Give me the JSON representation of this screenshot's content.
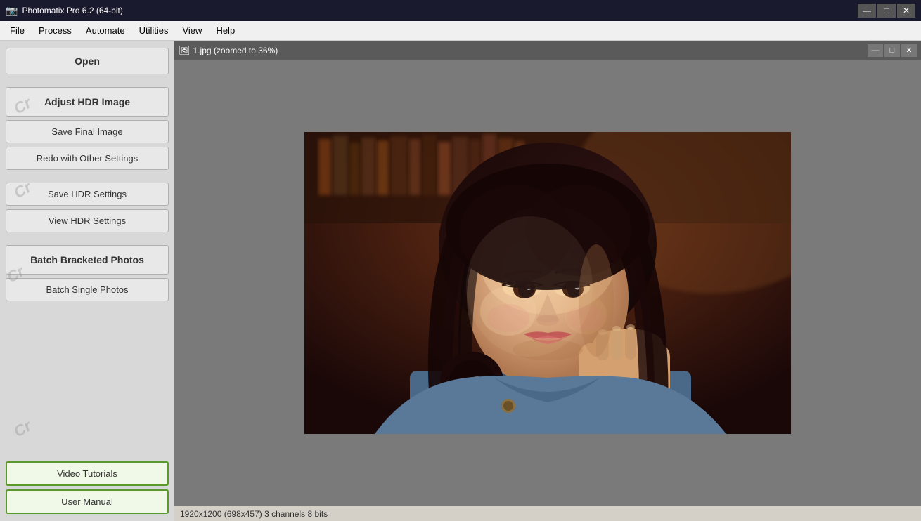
{
  "titlebar": {
    "icon": "📷",
    "title": "Photomatix Pro 6.2 (64-bit)",
    "minimize": "—",
    "maximize": "□",
    "close": "✕"
  },
  "menubar": {
    "items": [
      "File",
      "Process",
      "Automate",
      "Utilities",
      "View",
      "Help"
    ]
  },
  "sidebar": {
    "open_label": "Open",
    "adjust_hdr_label": "Adjust HDR Image",
    "save_final_label": "Save Final Image",
    "redo_label": "Redo with Other Settings",
    "save_hdr_settings_label": "Save HDR Settings",
    "view_hdr_settings_label": "View HDR Settings",
    "batch_bracketed_label": "Batch Bracketed Photos",
    "batch_single_label": "Batch Single Photos",
    "video_tutorials_label": "Video Tutorials",
    "user_manual_label": "User Manual",
    "watermarks": [
      "Cr",
      "Cr",
      "Cr",
      "Cr"
    ]
  },
  "image_window": {
    "title": "1.jpg (zoomed to 36%)",
    "minimize": "—",
    "restore": "□",
    "close": "✕"
  },
  "status_bar": {
    "text": "1920x1200 (698x457) 3 channels 8 bits"
  }
}
